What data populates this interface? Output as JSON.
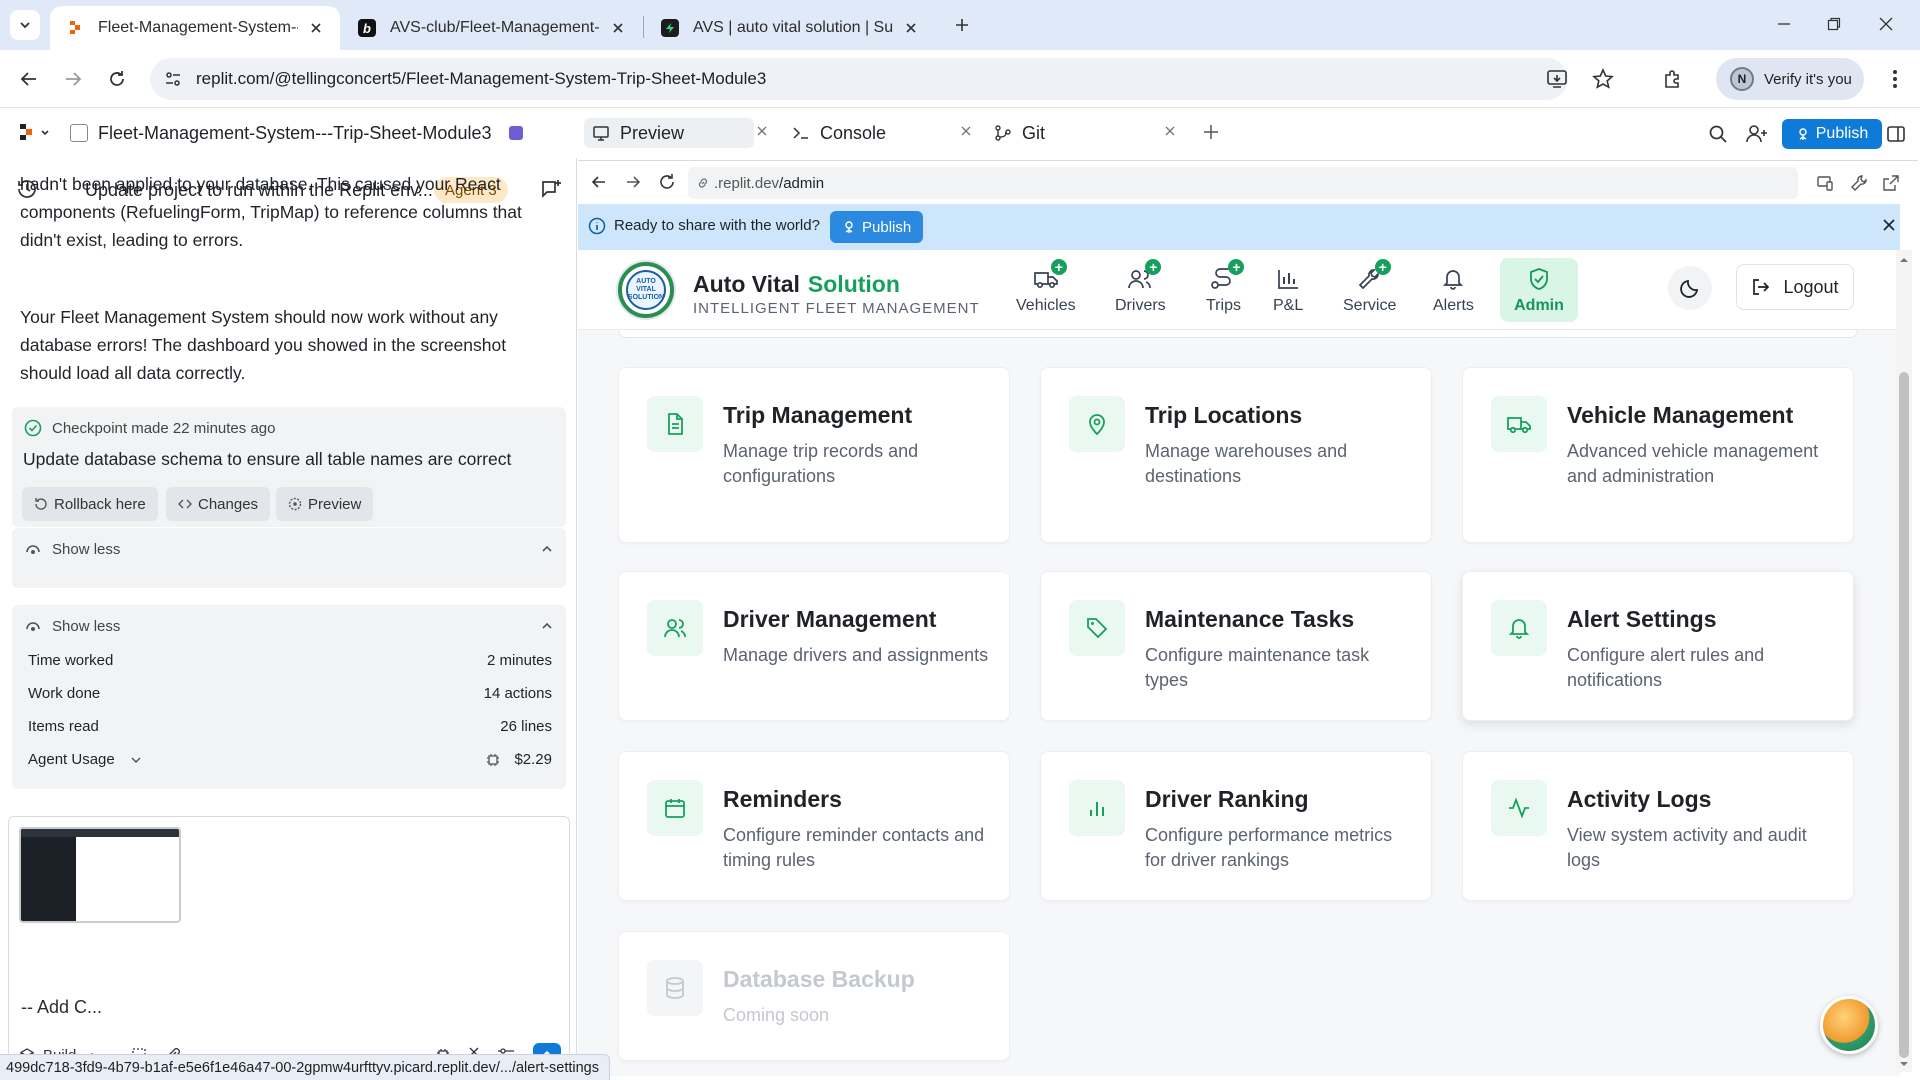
{
  "browser": {
    "tabs": [
      {
        "title": "Fleet-Management-System---Tr",
        "active": true
      },
      {
        "title": "AVS-club/Fleet-Management-Sy",
        "active": false
      },
      {
        "title": "AVS | auto vital solution | Supab",
        "active": false
      }
    ],
    "url": "replit.com/@tellingconcert5/Fleet-Management-System-Trip-Sheet-Module3",
    "verify_label": "Verify it's you",
    "avatar_letter": "N"
  },
  "replit": {
    "project_title": "Fleet-Management-System---Trip-Sheet-Module3",
    "conversation_title": "Update project to run within the Replit env...",
    "agent_badge": "Agent 3",
    "messages": [
      "hadn't been applied to your database. This caused your React components (RefuelingForm, TripMap) to reference columns that didn't exist, leading to errors.",
      "Your Fleet Management System should now work without any database errors! The dashboard you showed in the screenshot should load all data correctly."
    ],
    "checkpoint": {
      "header": "Checkpoint made 22 minutes ago",
      "description": "Update database schema to ensure all table names are correct",
      "buttons": [
        "Rollback here",
        "Changes",
        "Preview"
      ]
    },
    "show_less_1": "Show less",
    "show_less_2": "Show less",
    "stats": [
      {
        "label": "Time worked",
        "value": "2 minutes"
      },
      {
        "label": "Work done",
        "value": "14 actions"
      },
      {
        "label": "Items read",
        "value": "26 lines"
      },
      {
        "label": "Agent Usage",
        "value": "$2.29"
      }
    ],
    "composer_placeholder": "-- Add C...",
    "build_label": "Build",
    "status_url": "499dc718-3fd9-4b79-b1af-e5e6f1e46a47-00-2gpmw4urfttyv.picard.replit.dev/.../alert-settings"
  },
  "workspace": {
    "tabs": [
      "Preview",
      "Console",
      "Git"
    ],
    "publish_label": "Publish",
    "preview_url_prefix": ".replit.dev",
    "preview_url_path": "/admin"
  },
  "app": {
    "banner_text": "Ready to share with the world?",
    "banner_publish": "Publish",
    "brand": {
      "name": "Auto Vital",
      "accent": "Solution",
      "subtitle": "INTELLIGENT FLEET MANAGEMENT",
      "logo_text": "AUTO VITAL SOLUTION"
    },
    "nav": [
      {
        "label": "Vehicles",
        "icon": "truck-plus-icon"
      },
      {
        "label": "Drivers",
        "icon": "users-plus-icon"
      },
      {
        "label": "Trips",
        "icon": "route-plus-icon"
      },
      {
        "label": "P&L",
        "icon": "bar-chart-icon"
      },
      {
        "label": "Service",
        "icon": "wrench-plus-icon"
      },
      {
        "label": "Alerts",
        "icon": "bell-icon"
      },
      {
        "label": "Admin",
        "icon": "shield-check-icon",
        "active": true
      }
    ],
    "logout_label": "Logout",
    "cards": [
      {
        "title": "Trip Management",
        "desc": "Manage trip records and configurations",
        "icon": "file-text-icon"
      },
      {
        "title": "Trip Locations",
        "desc": "Manage warehouses and destinations",
        "icon": "map-pin-icon"
      },
      {
        "title": "Vehicle Management",
        "desc": "Advanced vehicle management and administration",
        "icon": "truck-icon"
      },
      {
        "title": "Driver Management",
        "desc": "Manage drivers and assignments",
        "icon": "users-icon"
      },
      {
        "title": "Maintenance Tasks",
        "desc": "Configure maintenance task types",
        "icon": "tag-icon"
      },
      {
        "title": "Alert Settings",
        "desc": "Configure alert rules and notifications",
        "icon": "bell-icon"
      },
      {
        "title": "Reminders",
        "desc": "Configure reminder contacts and timing rules",
        "icon": "calendar-icon"
      },
      {
        "title": "Driver Ranking",
        "desc": "Configure performance metrics for driver rankings",
        "icon": "bar-chart-icon"
      },
      {
        "title": "Activity Logs",
        "desc": "View system activity and audit logs",
        "icon": "activity-icon"
      },
      {
        "title": "Database Backup",
        "desc": "Coming soon",
        "icon": "database-icon",
        "disabled": true
      }
    ],
    "colors": {
      "accent": "#17a05d",
      "accent_bg": "#e9f8f0",
      "banner": "#cde6fb",
      "publish": "#0f7bd8"
    }
  }
}
